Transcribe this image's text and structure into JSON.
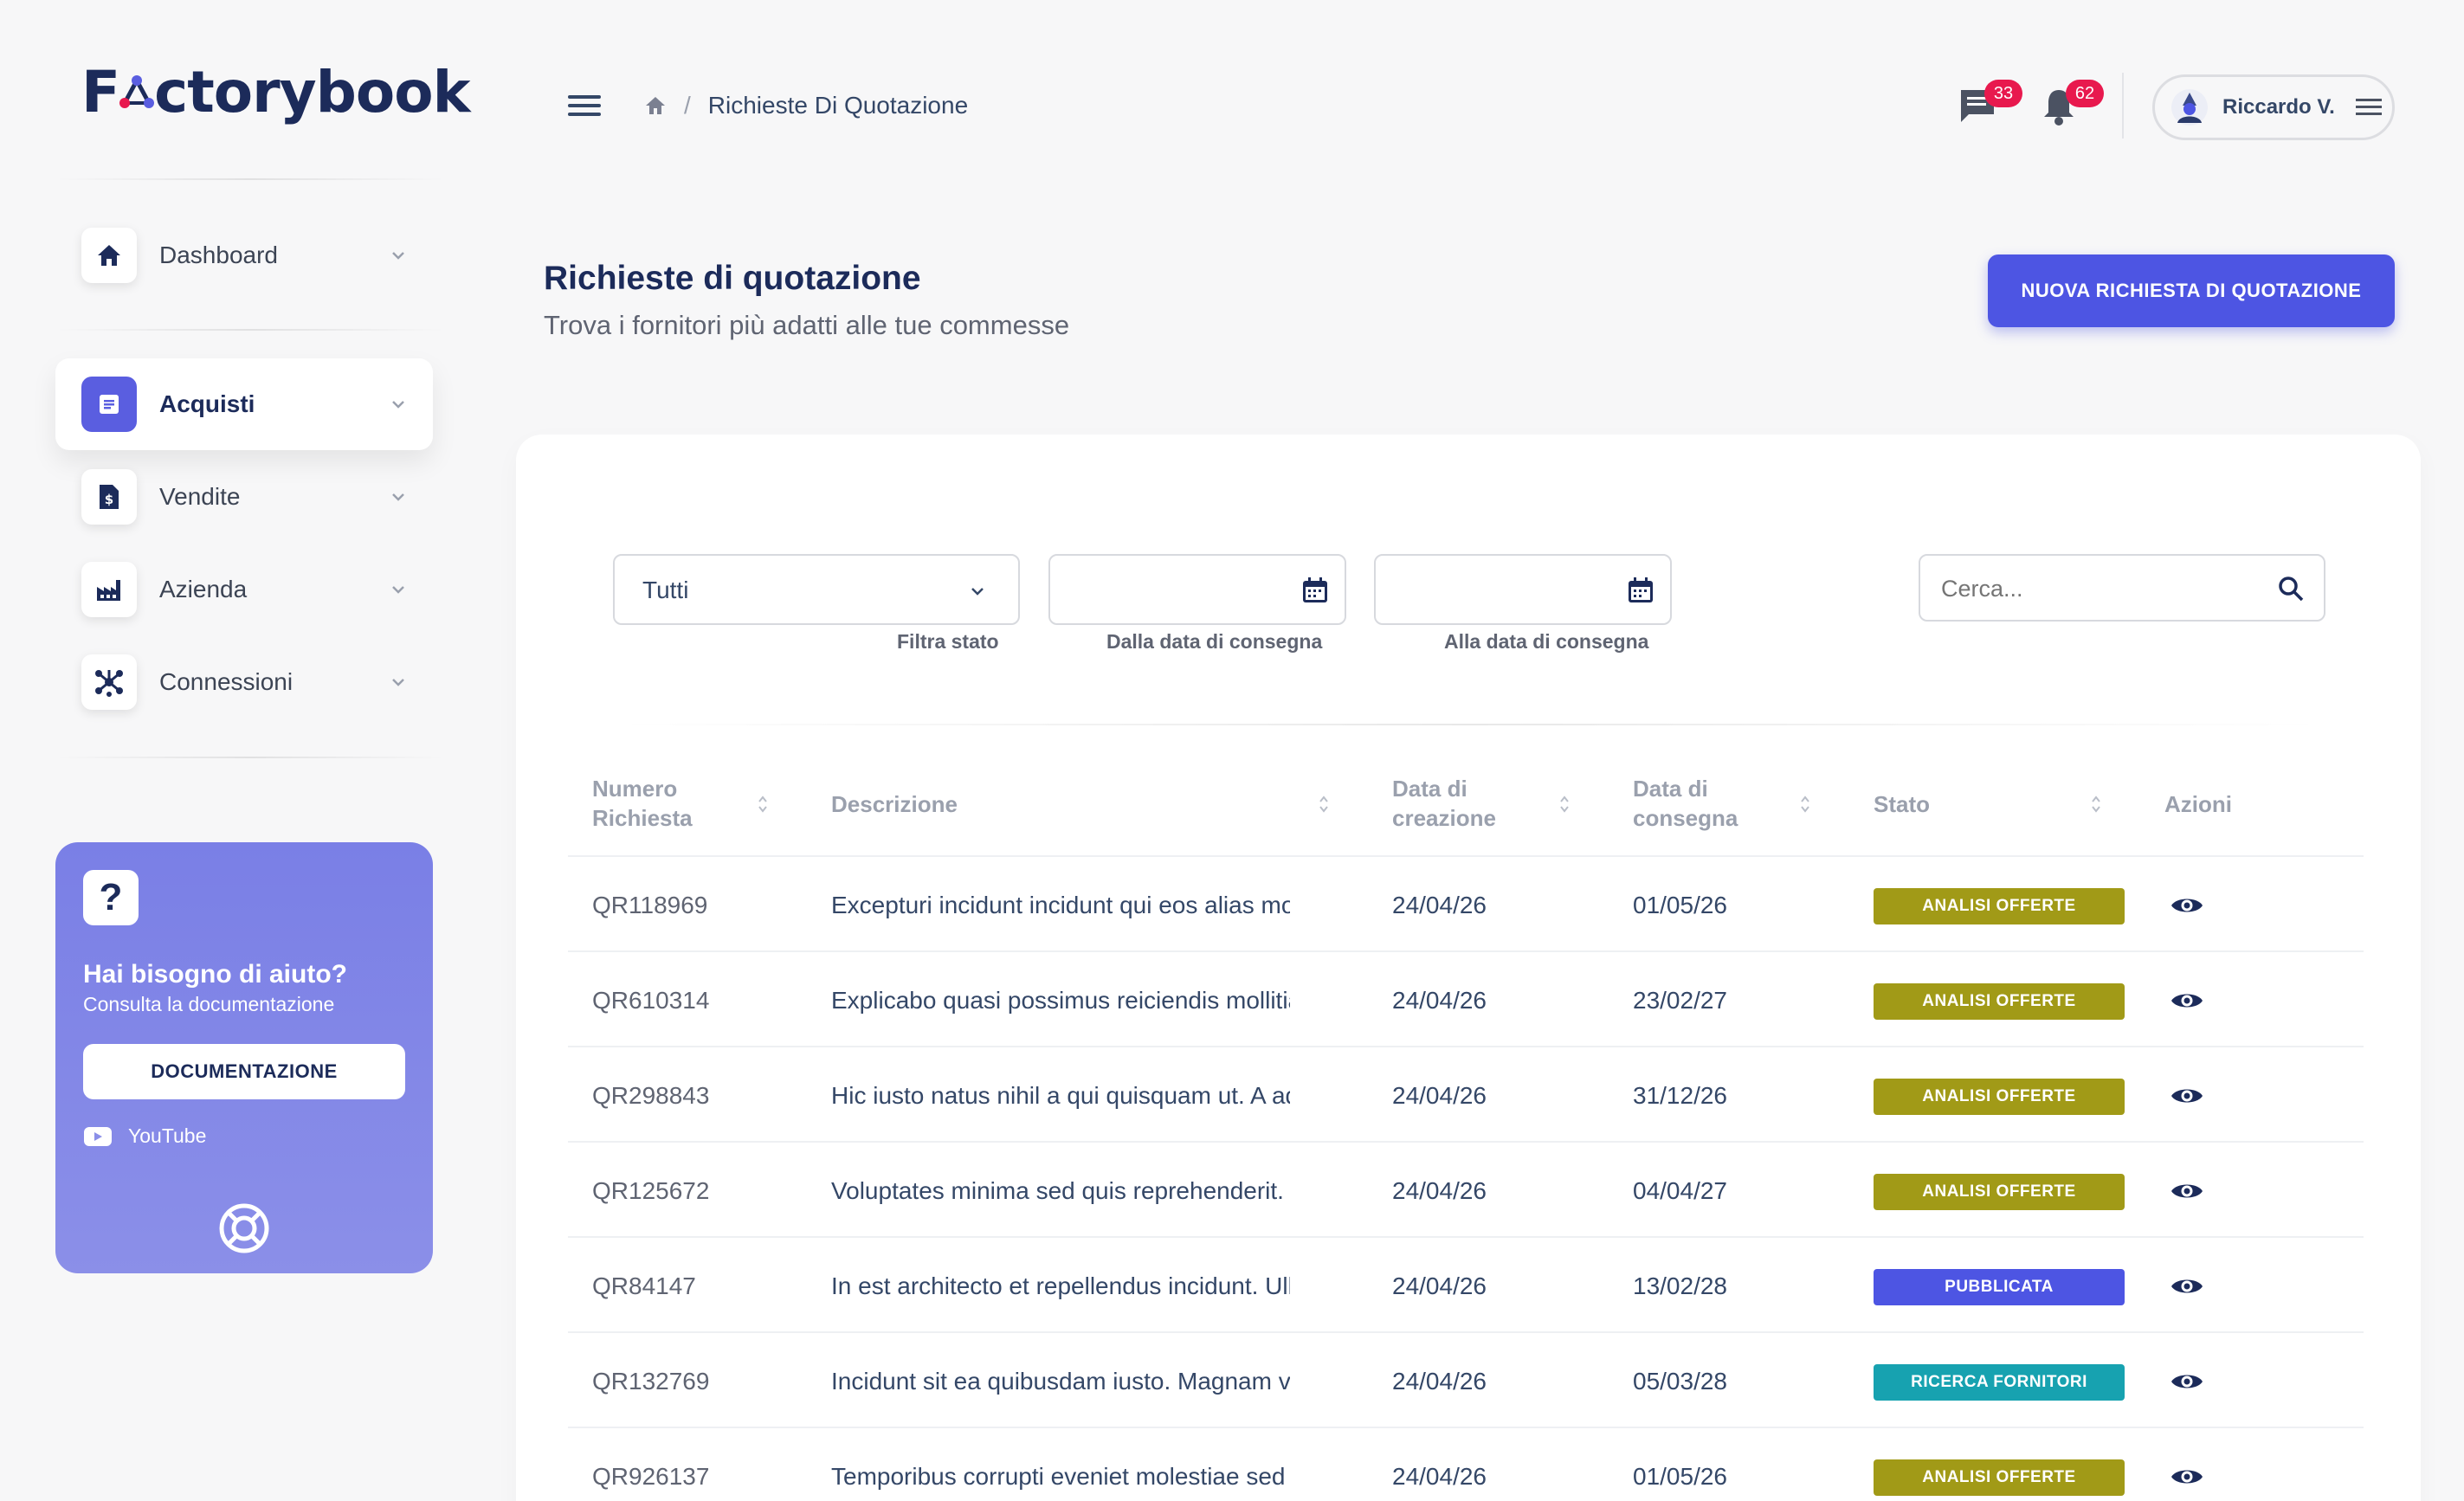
{
  "app": {
    "logo_text_pre": "F",
    "logo_text_post": "ctorybook"
  },
  "sidebar": {
    "items": [
      {
        "label": "Dashboard",
        "icon": "home-icon"
      },
      {
        "label": "Acquisti",
        "icon": "document-icon",
        "active": true
      },
      {
        "label": "Vendite",
        "icon": "invoice-icon"
      },
      {
        "label": "Azienda",
        "icon": "factory-icon"
      },
      {
        "label": "Connessioni",
        "icon": "network-icon"
      }
    ],
    "help": {
      "icon": "?",
      "title": "Hai bisogno di aiuto?",
      "subtitle": "Consulta la documentazione",
      "button": "DOCUMENTAZIONE",
      "youtube": "YouTube"
    }
  },
  "header": {
    "breadcrumb_sep": "/",
    "breadcrumb": "Richieste Di Quotazione",
    "messages_count": "33",
    "notifications_count": "62",
    "user_name": "Riccardo V."
  },
  "page": {
    "title": "Richieste di quotazione",
    "subtitle": "Trova i fornitori più adatti alle tue commesse",
    "new_button": "NUOVA RICHIESTA DI QUOTAZIONE"
  },
  "filters": {
    "status_value": "Tutti",
    "status_label": "Filtra stato",
    "from_label": "Dalla data di consegna",
    "to_label": "Alla data di consegna",
    "search_placeholder": "Cerca..."
  },
  "table": {
    "headers": {
      "numero_1": "Numero",
      "numero_2": "Richiesta",
      "descrizione": "Descrizione",
      "creazione_1": "Data di",
      "creazione_2": "creazione",
      "consegna_1": "Data di",
      "consegna_2": "consegna",
      "stato": "Stato",
      "azioni": "Azioni"
    },
    "rows": [
      {
        "numero": "QR118969",
        "descrizione": "Excepturi incidunt incidunt qui eos alias modi. A",
        "creazione": "24/04/26",
        "consegna": "01/05/26",
        "stato": "ANALISI OFFERTE",
        "color": "#a19a17"
      },
      {
        "numero": "QR610314",
        "descrizione": "Explicabo quasi possimus reiciendis mollitia ipsa",
        "creazione": "24/04/26",
        "consegna": "23/02/27",
        "stato": "ANALISI OFFERTE",
        "color": "#a19a17"
      },
      {
        "numero": "QR298843",
        "descrizione": "Hic iusto natus nihil a qui quisquam ut. A ad vo",
        "creazione": "24/04/26",
        "consegna": "31/12/26",
        "stato": "ANALISI OFFERTE",
        "color": "#a19a17"
      },
      {
        "numero": "QR125672",
        "descrizione": "Voluptates minima sed quis reprehenderit. Quo",
        "creazione": "24/04/26",
        "consegna": "04/04/27",
        "stato": "ANALISI OFFERTE",
        "color": "#a19a17"
      },
      {
        "numero": "QR84147",
        "descrizione": "In est architecto et repellendus incidunt. Ullam",
        "creazione": "24/04/26",
        "consegna": "13/02/28",
        "stato": "PUBBLICATA",
        "color": "#4d55e3"
      },
      {
        "numero": "QR132769",
        "descrizione": "Incidunt sit ea quibusdam iusto. Magnam verita",
        "creazione": "24/04/26",
        "consegna": "05/03/28",
        "stato": "RICERCA FORNITORI",
        "color": "#17a2b0"
      },
      {
        "numero": "QR926137",
        "descrizione": "Temporibus corrupti eveniet molestiae sed ipsa",
        "creazione": "24/04/26",
        "consegna": "01/05/26",
        "stato": "ANALISI OFFERTE",
        "color": "#a19a17"
      }
    ]
  }
}
